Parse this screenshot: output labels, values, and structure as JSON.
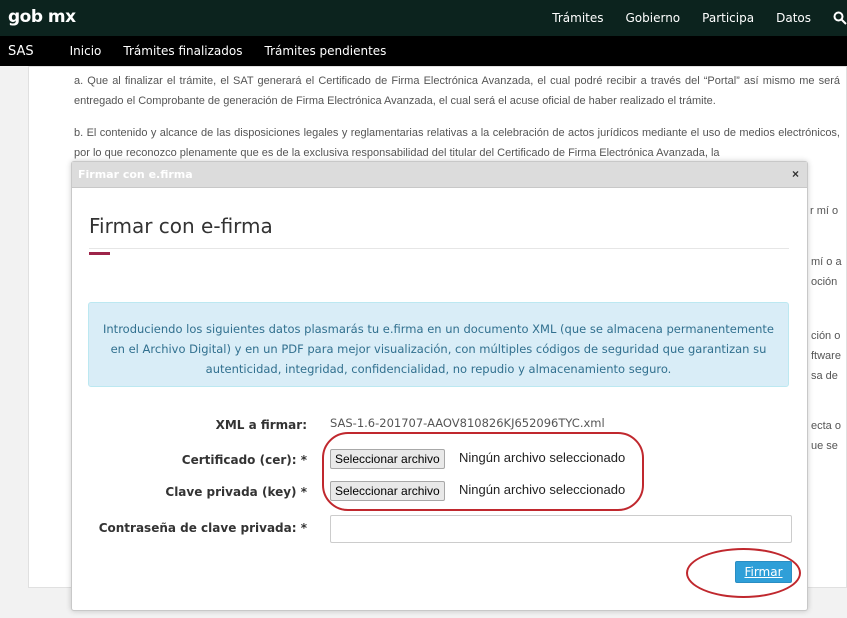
{
  "header": {
    "logo": "gob mx",
    "nav": [
      "Trámites",
      "Gobierno",
      "Participa",
      "Datos"
    ]
  },
  "subnav": {
    "brand": "SAS",
    "links": [
      "Inicio",
      "Trámites finalizados",
      "Trámites pendientes"
    ]
  },
  "background": {
    "para_a": "a. Que al finalizar el trámite, el SAT generará el Certificado de Firma Electrónica Avanzada, el cual podré recibir a través del “Portal” así mismo me será entregado el Comprobante de generación de Firma Electrónica Avanzada, el cual será el acuse oficial de haber realizado el trámite.",
    "para_b": "b. El contenido y alcance de las disposiciones legales y reglamentarias relativas a la celebración de actos jurídicos mediante el uso de medios electrónicos, por lo que reconozco plenamente que es de la exclusiva responsabilidad del titular del Certificado de Firma Electrónica Avanzada, la",
    "fragments": [
      "r mí o",
      "mí o a",
      "oción",
      "ción o",
      "ftware",
      "sa de",
      "ecta o",
      "ue se"
    ]
  },
  "modal": {
    "titlebar": "Firmar con e.firma",
    "close": "×",
    "heading": "Firmar con e-firma",
    "info": "Introduciendo los siguientes datos plasmarás tu e.firma en un documento XML (que se almacena permanentemente en el Archivo Digital) y en un PDF para mejor visualización, con múltiples códigos de seguridad que garantizan su autenticidad, integridad, confidencialidad, no repudio y almacenamiento seguro.",
    "fields": {
      "xml_label": "XML a firmar:",
      "xml_value": "SAS-1.6-201707-AAOV810826KJ652096TYC.xml",
      "cert_label": "Certificado (cer): *",
      "key_label": "Clave privada (key) *",
      "pwd_label": "Contraseña de clave privada: *",
      "file_button": "Seleccionar archivo",
      "file_status": "Ningún archivo seleccionado",
      "pwd_value": ""
    },
    "submit": "Firmar"
  },
  "colors": {
    "topbar": "#0c231e",
    "subbar": "#000000",
    "accent": "#9d2449",
    "info_bg": "#d9edf7",
    "info_text": "#31708f",
    "button": "#2f9fd8",
    "highlight": "#c0282e"
  }
}
